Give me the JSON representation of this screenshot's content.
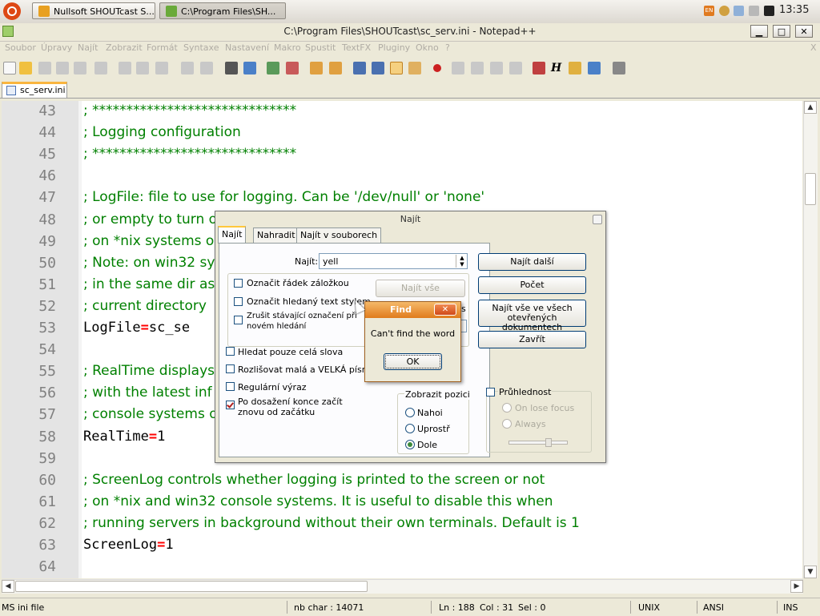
{
  "taskbar": {
    "tasks": [
      {
        "label": "Nullsoft SHOUTcast S..."
      },
      {
        "label": "C:\\Program Files\\SH..."
      }
    ],
    "tray_lang": "EN",
    "clock": "13:35"
  },
  "window": {
    "title": "C:\\Program Files\\SHOUTcast\\sc_serv.ini - Notepad++",
    "minimize": "▁",
    "maximize": "□",
    "close": "✕",
    "menu_close": "X"
  },
  "menu": [
    "Soubor",
    "Úpravy",
    "Najít",
    "Zobrazit",
    "Formát",
    "Syntaxe",
    "Nastavení",
    "Makro",
    "Spustit",
    "TextFX",
    "Pluginy",
    "Okno",
    "?"
  ],
  "tab": {
    "label": "sc_serv.ini"
  },
  "editor": {
    "lines": [
      {
        "num": "43",
        "kind": "comment",
        "text": "; ******************************"
      },
      {
        "num": "44",
        "kind": "comment",
        "text": "; Logging configuration"
      },
      {
        "num": "45",
        "kind": "comment",
        "text": "; ******************************"
      },
      {
        "num": "46",
        "kind": "blank",
        "text": ""
      },
      {
        "num": "47",
        "kind": "comment",
        "text": "; LogFile: file to use for logging. Can be '/dev/null' or 'none'"
      },
      {
        "num": "48",
        "kind": "comment",
        "text": "; or empty to turn o"
      },
      {
        "num": "49",
        "kind": "comment",
        "text": "; on *nix systems o"
      },
      {
        "num": "50",
        "kind": "comment",
        "text": "; Note: on win32 sy"
      },
      {
        "num": "51",
        "kind": "comment",
        "text": "; in the same dir as"
      },
      {
        "num": "52",
        "kind": "comment",
        "text": "; current directory"
      },
      {
        "num": "53",
        "kind": "kv",
        "key": "LogFile",
        "value": "sc_se"
      },
      {
        "num": "54",
        "kind": "blank",
        "text": ""
      },
      {
        "num": "55",
        "kind": "comment",
        "text": "; RealTime displays"
      },
      {
        "num": "56",
        "kind": "comment",
        "text": "; with the latest inf"
      },
      {
        "num": "57",
        "kind": "comment",
        "text": "; console systems o"
      },
      {
        "num": "58",
        "kind": "kv",
        "key": "RealTime",
        "value": "1"
      },
      {
        "num": "59",
        "kind": "blank",
        "text": ""
      },
      {
        "num": "60",
        "kind": "comment",
        "text": "; ScreenLog controls whether logging is printed to the screen or not"
      },
      {
        "num": "61",
        "kind": "comment",
        "text": "; on *nix and win32 console systems. It is useful to disable this when"
      },
      {
        "num": "62",
        "kind": "comment",
        "text": "; running servers in background without their own terminals. Default is 1"
      },
      {
        "num": "63",
        "kind": "kv",
        "key": "ScreenLog",
        "value": "1"
      },
      {
        "num": "64",
        "kind": "blank",
        "text": ""
      }
    ]
  },
  "status": {
    "type": "MS ini file",
    "chars": "nb char : 14071",
    "ln": "Ln : 188",
    "col": "Col : 31",
    "sel": "Sel : 0",
    "eol": "UNIX",
    "enc": "ANSI",
    "mode": "INS"
  },
  "find_dialog": {
    "title": "Najít",
    "tabs": [
      "Najít",
      "Nahradit",
      "Najít v souborech"
    ],
    "find_label": "Najít:",
    "find_value": "yell",
    "chk_mark_line": "Označit řádek záložkou",
    "chk_mark_style": "Označit hledaný text stylem",
    "chk_clear_1": "Zrušit stávající označení při",
    "chk_clear_2": "novém hledání",
    "find_all_btn": "Najít vše",
    "partial_s": "s",
    "whole_word": "Hledat pouze celá slova",
    "match_case": "Rozlišovat malá a VELKÁ písm.",
    "regex": "Regulární výraz",
    "wrap_1": "Po dosažení konce začít",
    "wrap_2": "znovu od začátku",
    "direction_label": "Zobrazit pozici",
    "dir_up": "Nahoi",
    "dir_mid": "Uprostř",
    "dir_down": "Dole",
    "transparency": "Průhlednost",
    "on_lose_focus": "On lose focus",
    "always": "Always",
    "btn_find_next": "Najít další",
    "btn_count": "Počet",
    "btn_find_all_1": "Najít vše ve všech",
    "btn_find_all_2": "otevřených dokumentech",
    "btn_close": "Zavřít"
  },
  "popup": {
    "title": "Find",
    "close": "✕",
    "message": "Can't find the word",
    "ok": "OK"
  }
}
